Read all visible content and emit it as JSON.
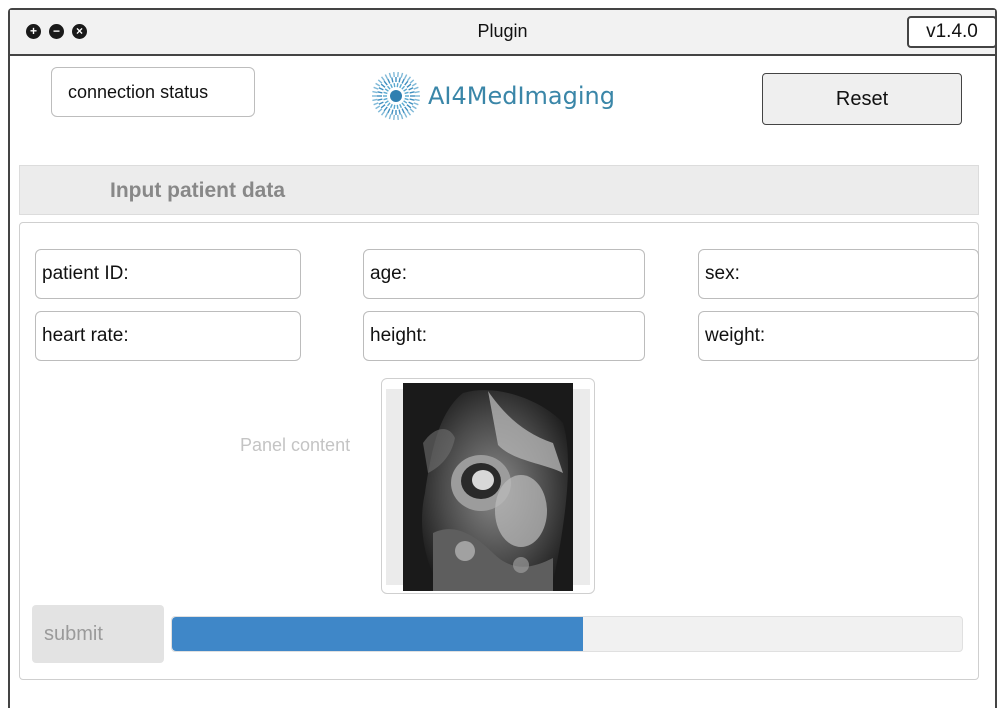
{
  "window": {
    "title": "Plugin",
    "version": "v1.4.0",
    "buttons": [
      {
        "icon": "plus-circle-icon",
        "glyph": "+"
      },
      {
        "icon": "minus-circle-icon",
        "glyph": "−"
      },
      {
        "icon": "close-circle-icon",
        "glyph": "×"
      }
    ]
  },
  "header": {
    "connection_status": "connection status",
    "logo_text": "AI4MedImaging",
    "reset_label": "Reset"
  },
  "section": {
    "title": "Input patient data"
  },
  "fields": {
    "patient_id": "patient ID:",
    "age": "age:",
    "sex": "sex:",
    "heart_rate": "heart rate:",
    "height": "height:",
    "weight": "weight:"
  },
  "panel": {
    "content_label": "Panel content",
    "image": "cardiac-mri-image"
  },
  "footer": {
    "submit_label": "submit",
    "progress": 0.52
  },
  "colors": {
    "accent": "#3f87c8",
    "logo": "#3a86a8"
  }
}
